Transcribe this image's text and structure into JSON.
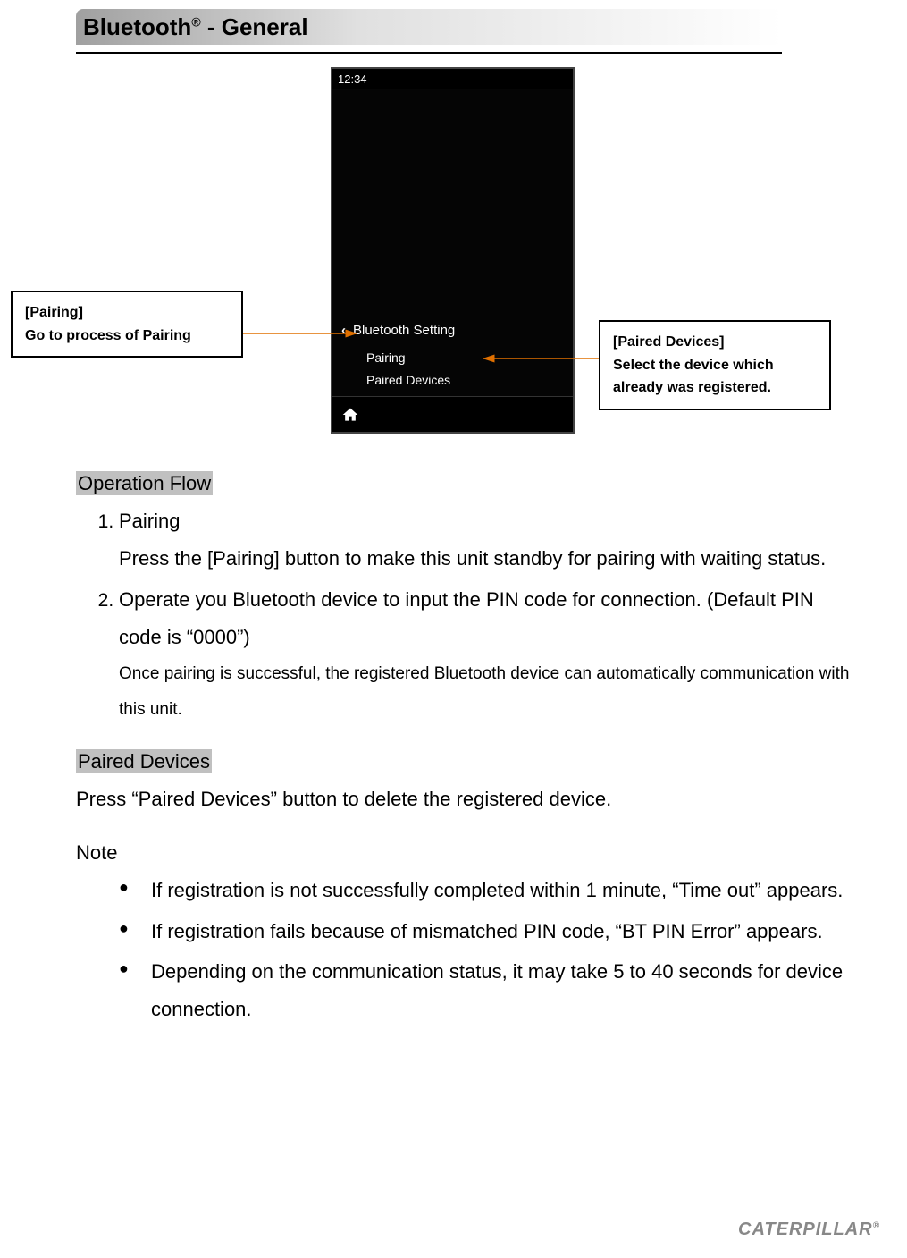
{
  "header": {
    "title_prefix": "Bluetooth",
    "title_suffix": " - General",
    "registered_mark": "®"
  },
  "phone": {
    "time": "12:34",
    "setting_title": "Bluetooth Setting",
    "menu": {
      "pairing": "Pairing",
      "paired_devices": "Paired Devices"
    }
  },
  "callouts": {
    "left": {
      "title": "[Pairing]",
      "body": "Go to process of Pairing"
    },
    "right": {
      "title": "[Paired Devices]",
      "body": "Select the device which already was registered."
    }
  },
  "sections": {
    "operation_flow": {
      "heading": "Operation Flow",
      "items": [
        {
          "title": "Pairing",
          "body_large": "Press the [Pairing] button to make this unit standby for pairing with waiting status."
        },
        {
          "title": "Operate you Bluetooth device to input the PIN code for connection. (Default PIN code is “0000”)",
          "body_small": "Once pairing is successful, the registered Bluetooth device can automatically communication with this unit."
        }
      ]
    },
    "paired_devices": {
      "heading": "Paired Devices",
      "body": "Press “Paired Devices” button to delete the registered device."
    },
    "note": {
      "heading": "Note",
      "items": [
        "If registration is not successfully completed within 1 minute, “Time out” appears.",
        "If registration fails because of mismatched PIN code, “BT PIN Error” appears.",
        "Depending on the communication status, it may take 5 to 40 seconds for device connection."
      ]
    }
  },
  "footer": {
    "logo_text": "CATERPILLAR",
    "logo_mark": "®"
  }
}
